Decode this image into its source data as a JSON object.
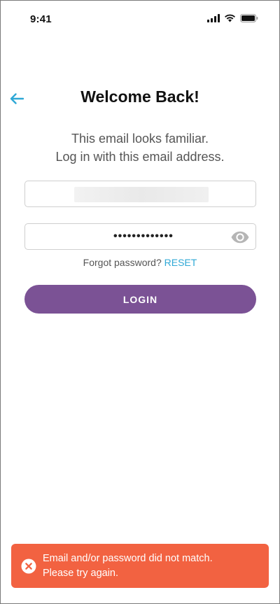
{
  "status_bar": {
    "time": "9:41",
    "icons": [
      "cellular-signal-icon",
      "wifi-icon",
      "battery-icon"
    ]
  },
  "header": {
    "back_icon": "arrow-left-icon",
    "title": "Welcome Back!"
  },
  "subtitle": {
    "line1": "This email looks familiar.",
    "line2": "Log in with this email address."
  },
  "form": {
    "email_value": "",
    "password_mask": "•••••••••••••",
    "password_toggle_icon": "eye-icon",
    "forgot_label": "Forgot password?",
    "reset_label": "RESET",
    "login_label": "LOGIN"
  },
  "toast": {
    "icon": "close-circle-icon",
    "line1": "Email and/or password did not match.",
    "line2": "Please try again."
  },
  "colors": {
    "accent_purple": "#7b5295",
    "link_blue": "#2fa8d6",
    "error_orange": "#f26241"
  }
}
